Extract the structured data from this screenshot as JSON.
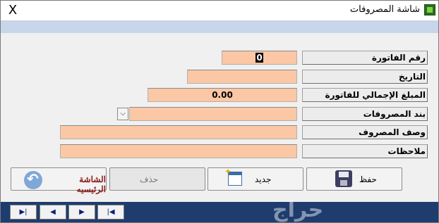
{
  "window": {
    "title": "شاشة المصروفات",
    "close_symbol": "X"
  },
  "form": {
    "fields": [
      {
        "label": "رقم الفاتورة",
        "value": "0"
      },
      {
        "label": "التاريخ",
        "value": ""
      },
      {
        "label": "المبلغ الإجمالي للفاتورة",
        "value": "0.00"
      },
      {
        "label": "بند المصروفات",
        "value": "",
        "dropdown_icon": "chevron-down-icon"
      },
      {
        "label": "وصف المصروف",
        "value": ""
      },
      {
        "label": "ملاحظات",
        "value": ""
      }
    ]
  },
  "buttons": {
    "save": "حفظ",
    "new": "جديد",
    "delete": "حذف",
    "home": "الشاشة الرئيسيه"
  },
  "nav": {
    "last": "▶|",
    "next": "◀",
    "prev": "▶",
    "first": "|◀"
  },
  "watermark": "حراج",
  "colors": {
    "field_bg": "#fbc7a4",
    "band": "#c8d5ea",
    "nav_bar": "#1e3c6e",
    "home_text": "#8b1a1a"
  }
}
